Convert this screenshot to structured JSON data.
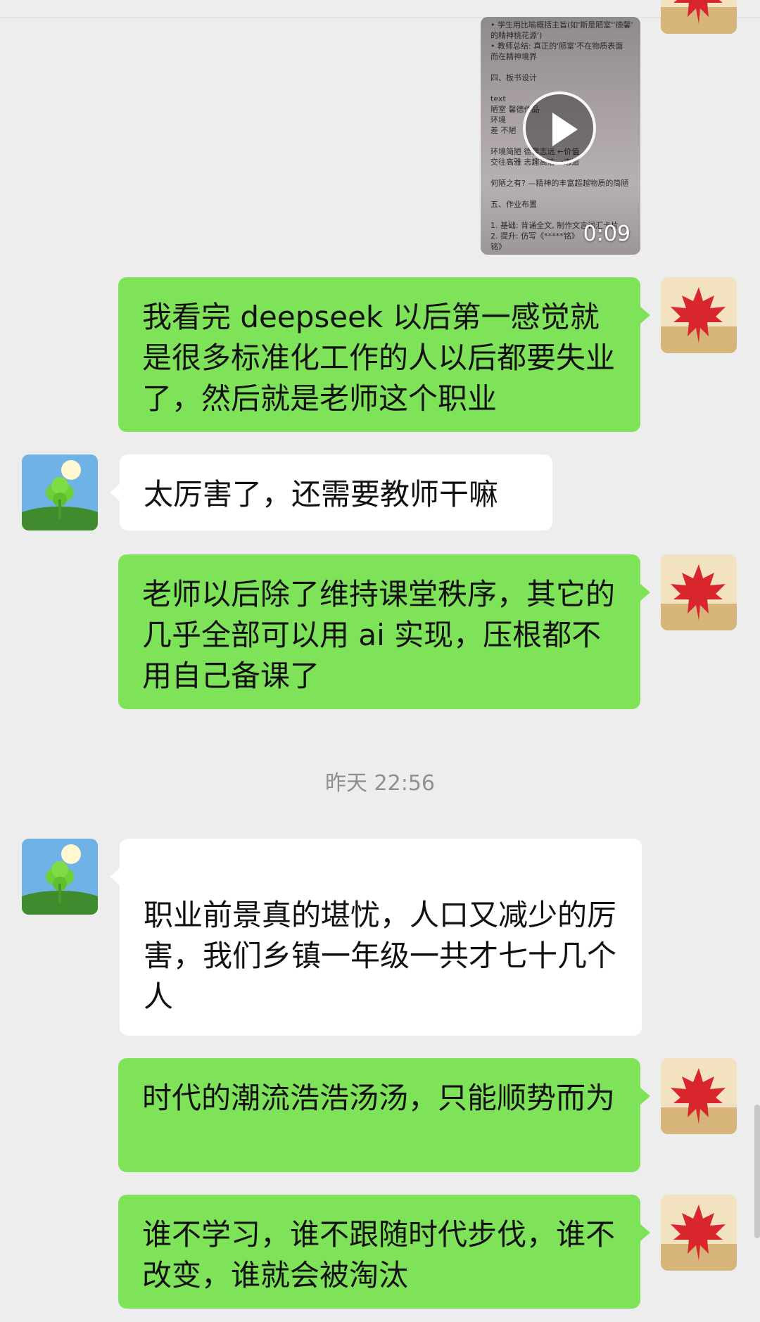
{
  "video": {
    "duration": "0:09",
    "doc_lines": [
      "• 学生用比喻概括主旨(如'斯是陋室''德馨'",
      "的精神桃花源')",
      "• 教师总结: 真正的'陋室'不在物质表面",
      "而在精神境界",
      "",
      "四、板书设计",
      "",
      "text",
      "      陋室    馨德作品",
      "      环境",
      "   差          不陋",
      "",
      "   环境简陋  德馨志远   ←价值",
      "   交往高雅  志趣高洁   →志道",
      "",
      "   何陋之有? —精神的丰富超越物质的简陋",
      "",
      "五、作业布置",
      "",
      "1. 基础: 背诵全文, 制作文言词汇卡片",
      "2. 提升: 仿写《*****铭》",
      "铭》"
    ]
  },
  "messages": [
    {
      "side": "right",
      "text": "我看完 deepseek 以后第一感觉就是很多标准化工作的人以后都要失业了，然后就是老师这个职业"
    },
    {
      "side": "left",
      "text": "太厉害了，还需要教师干嘛"
    },
    {
      "side": "right",
      "text": "老师以后除了维持课堂秩序，其它的几乎全部可以用 ai 实现，压根都不用自己备课了"
    },
    {
      "side": "left",
      "text": "职业前景真的堪忧，人口又减少的厉害，我们乡镇一年级一共才七十几个人"
    },
    {
      "side": "right",
      "text": "时代的潮流浩浩汤汤，只能顺势而为"
    },
    {
      "side": "right",
      "text": "谁不学习，谁不跟随时代步伐，谁不改变，谁就会被淘汰"
    }
  ],
  "timestamp": "昨天 22:56",
  "colors": {
    "background": "#ededed",
    "green_bubble": "#7fe35a",
    "white_bubble": "#ffffff"
  },
  "icons": {
    "self_avatar": "red-maple-leaf-icon",
    "other_avatar": "four-leaf-clover-icon",
    "play": "play-icon"
  }
}
